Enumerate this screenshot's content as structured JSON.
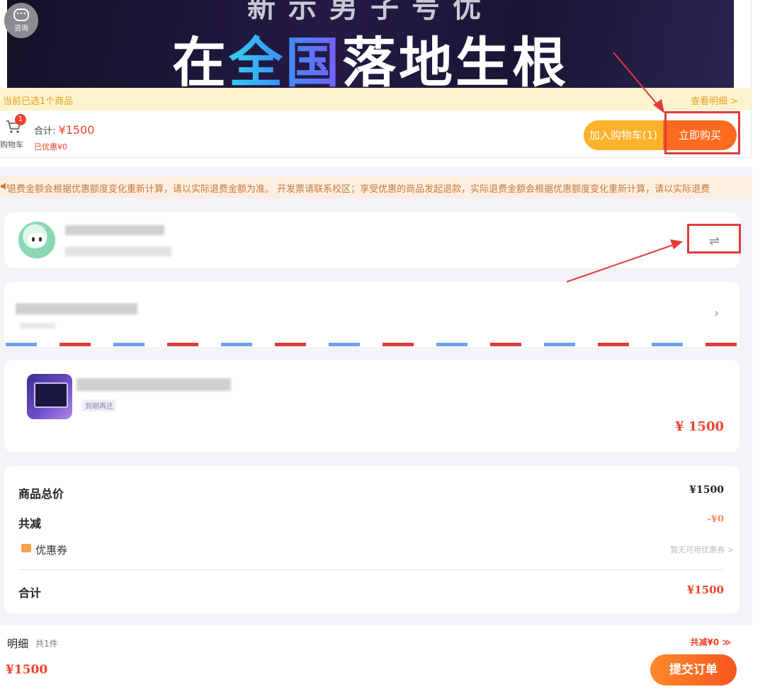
{
  "top": {
    "banner_ghost_text": "新示男子号优",
    "banner_title_parts": [
      "在",
      "全国",
      "落地生根"
    ],
    "consult_label": "咨询",
    "selected_notice": "当前已选1个商品",
    "view_details": "查看明细 >",
    "cart_badge": "1",
    "cart_label": "购物车",
    "total_prefix": "合计: ",
    "total_value": "¥1500",
    "discount_text": "已优惠¥0",
    "add_to_cart": "加入购物车(1)",
    "buy_now": "立即购买"
  },
  "order": {
    "marquee": "退费金额会根据优惠额度变化重新计算，请以实际退费金额为准。       开发票请联系校区；享受优惠的商品发起退款，实际退费金额会根据优惠额度变化重新计算，请以实际退费",
    "swap_icon": "⇌",
    "chevron": "›",
    "product_sub": "到期再还",
    "product_price": "¥ 1500",
    "summary": {
      "total_label": "商品总价",
      "total_value": "¥1500",
      "reduce_label": "共减",
      "reduce_value": "-¥0",
      "coupon_label": "优惠券",
      "coupon_value": "暂无可用优惠券 >",
      "sum_label": "合计",
      "sum_value": "¥1500"
    },
    "footer": {
      "detail_label": "明细",
      "count_label": "共1件",
      "reduce_toggle": "共减¥0 ≫",
      "price": "¥1500",
      "submit": "提交订单"
    }
  },
  "colors": {
    "accent": "#f0412b",
    "cta_orange": "#fb6a1f",
    "cta_yellow": "#fbb12a",
    "annotation_red": "#e23b3b"
  }
}
